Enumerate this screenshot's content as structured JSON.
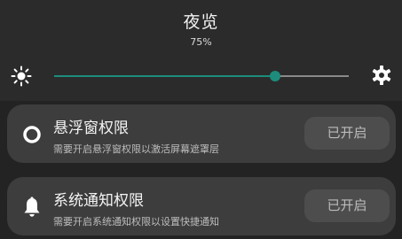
{
  "header": {
    "title": "夜览",
    "percent_label": "75%",
    "brightness": 0.75
  },
  "icons": {
    "brightness": "sun-icon",
    "settings": "gear-icon",
    "overlay": "ring-icon",
    "notification": "bell-icon"
  },
  "colors": {
    "accent": "#1d8c7c",
    "card_background": "#3d3d3d",
    "button_background": "#4d4d4d"
  },
  "permissions": [
    {
      "title": "悬浮窗权限",
      "description": "需要开启悬浮窗权限以激活屏幕遮罩层",
      "button_label": "已开启"
    },
    {
      "title": "系统通知权限",
      "description": "需要开启系统通知权限以设置快捷通知",
      "button_label": "已开启"
    }
  ]
}
